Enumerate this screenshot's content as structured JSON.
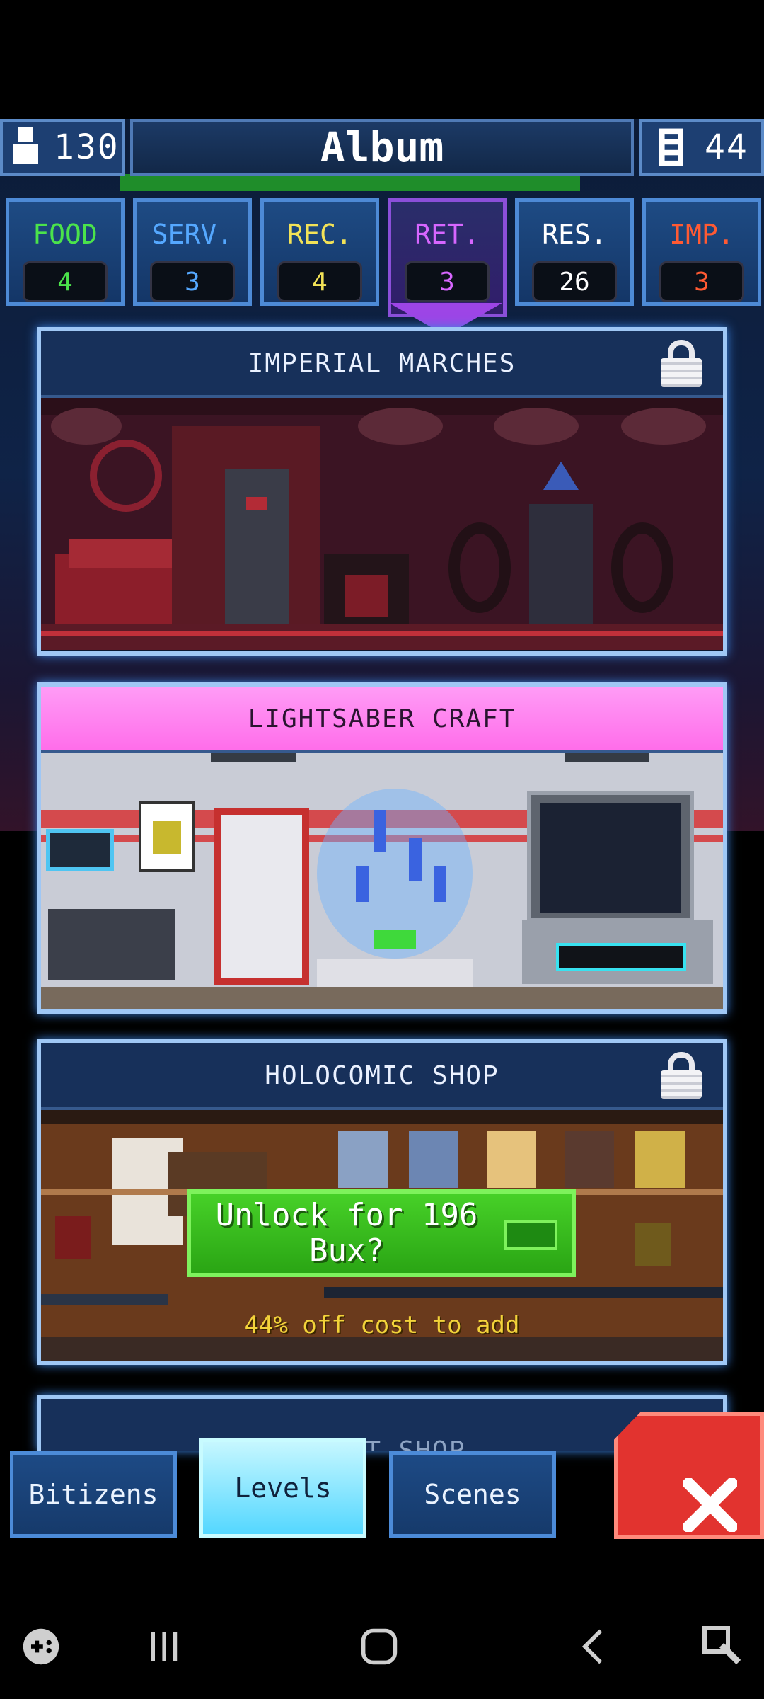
{
  "header": {
    "title": "Album",
    "population": "130",
    "floors": "44"
  },
  "tabs": [
    {
      "label": "FOOD",
      "count": "4",
      "color": "#4be34b"
    },
    {
      "label": "SERV.",
      "count": "3",
      "color": "#55a8ff"
    },
    {
      "label": "REC.",
      "count": "4",
      "color": "#f2e257"
    },
    {
      "label": "RET.",
      "count": "3",
      "color": "#d766ff",
      "active": true
    },
    {
      "label": "RES.",
      "count": "26",
      "color": "#ffffff"
    },
    {
      "label": "IMP.",
      "count": "3",
      "color": "#ff5a33"
    }
  ],
  "cards": {
    "imperial": {
      "title": "IMPERIAL MARCHES",
      "locked": true
    },
    "lightsaber": {
      "title": "LIGHTSABER CRAFT",
      "locked": false
    },
    "holocomic": {
      "title": "HOLOCOMIC SHOP",
      "locked": true,
      "unlock_label": "Unlock for 196 Bux?",
      "discount_text": "44% off cost to add"
    },
    "next": {
      "title": "GHOST SHOP"
    }
  },
  "bottom_nav": {
    "bitizens": "Bitizens",
    "levels": "Levels",
    "scenes": "Scenes"
  },
  "colors": {
    "accent_pink": "#ff88f2",
    "unlock_green": "#38c31e",
    "close_red": "#e2332f"
  }
}
